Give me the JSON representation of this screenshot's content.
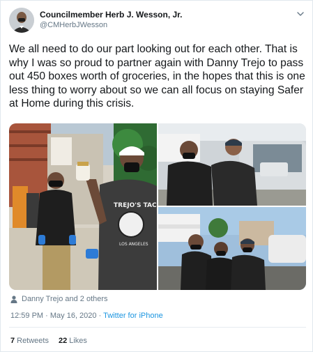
{
  "header": {
    "display_name": "Councilmember Herb J. Wesson, Jr.",
    "handle": "@CMHerbJWesson",
    "avatar_icon": "profile-photo-icon",
    "menu_icon": "chevron-down-icon"
  },
  "tweet": {
    "text": "We all need to do our part looking out for each other. That is why I was so proud to partner again with Danny Trejo to pass out 450 boxes worth of groceries, in the hopes that this is one less thing to worry about so we can all focus on staying Safer at Home during this crisis."
  },
  "media": {
    "count": 3,
    "shirt_text": "TREJO'S TACOS",
    "shirt_subtext": "LOS ANGELES"
  },
  "tagged": {
    "icon": "person-icon",
    "label": "Danny Trejo and 2 others"
  },
  "meta": {
    "time": "12:59 PM",
    "separator1": " · ",
    "date": "May 16, 2020",
    "separator2": " · ",
    "source": "Twitter for iPhone"
  },
  "stats": {
    "retweets_count": "7",
    "retweets_label": "Retweets",
    "likes_count": "22",
    "likes_label": "Likes"
  },
  "colors": {
    "text": "#14171a",
    "secondary": "#657786",
    "link": "#1b95e0",
    "border": "#e1e8ed"
  }
}
